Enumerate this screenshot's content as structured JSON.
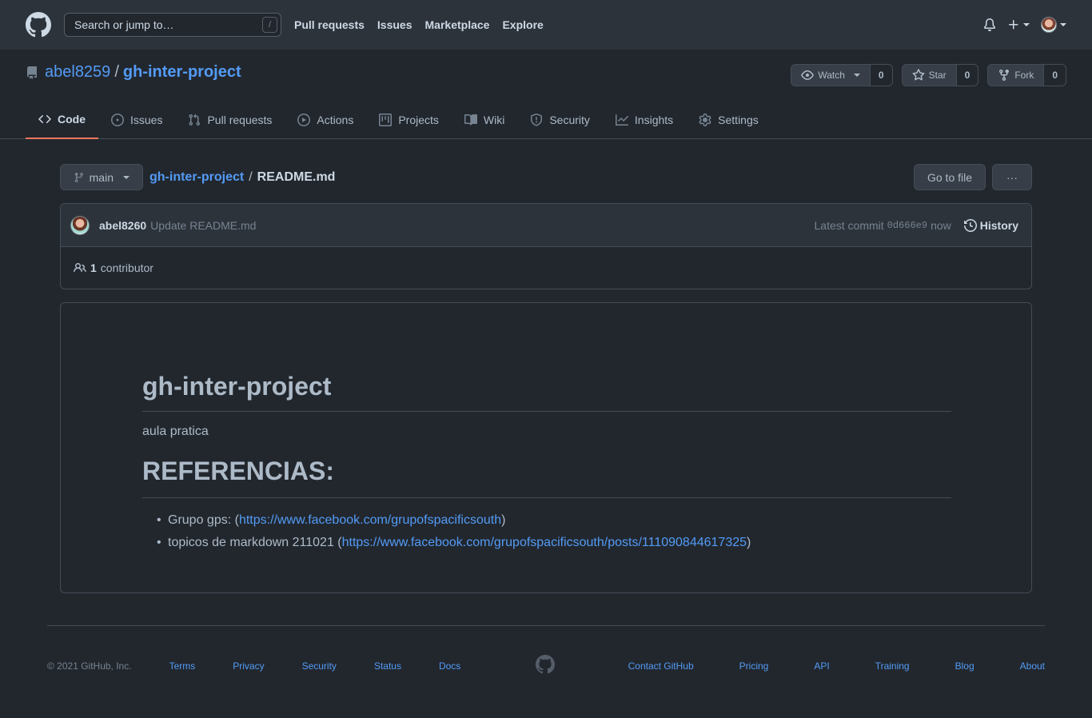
{
  "header": {
    "search_placeholder": "Search or jump to…",
    "search_key": "/",
    "nav": [
      "Pull requests",
      "Issues",
      "Marketplace",
      "Explore"
    ]
  },
  "repo": {
    "owner": "abel8259",
    "separator": "/",
    "name": "gh-inter-project",
    "watch_label": "Watch",
    "watch_count": "0",
    "star_label": "Star",
    "star_count": "0",
    "fork_label": "Fork",
    "fork_count": "0"
  },
  "tabs": [
    {
      "label": "Code",
      "icon": "code-icon"
    },
    {
      "label": "Issues",
      "icon": "issue-icon"
    },
    {
      "label": "Pull requests",
      "icon": "pull-request-icon"
    },
    {
      "label": "Actions",
      "icon": "play-icon"
    },
    {
      "label": "Projects",
      "icon": "project-icon"
    },
    {
      "label": "Wiki",
      "icon": "book-icon"
    },
    {
      "label": "Security",
      "icon": "shield-icon"
    },
    {
      "label": "Insights",
      "icon": "graph-icon"
    },
    {
      "label": "Settings",
      "icon": "gear-icon"
    }
  ],
  "file": {
    "branch": "main",
    "repo_link": "gh-inter-project",
    "slash": "/",
    "filename": "README.md",
    "goto_label": "Go to file",
    "more_label": "···"
  },
  "commit": {
    "author": "abel8260",
    "message": "Update README.md",
    "latest_label": "Latest commit",
    "sha": "0d666e9",
    "time": "now",
    "history_label": "History",
    "contributors_count": "1",
    "contributors_label": "contributor"
  },
  "readme": {
    "title": "gh-inter-project",
    "paragraph": "aula pratica",
    "section_title": "REFERENCIAS:",
    "refs": [
      {
        "prefix": "Grupo gps: (",
        "link": "https://www.facebook.com/grupofspacificsouth",
        "suffix": ")"
      },
      {
        "prefix": "topicos de markdown 211021 (",
        "link": "https://www.facebook.com/grupofspacificsouth/posts/111090844617325",
        "suffix": ")"
      }
    ]
  },
  "footer": {
    "copyright": "© 2021 GitHub, Inc.",
    "left_links": [
      "Terms",
      "Privacy",
      "Security",
      "Status",
      "Docs"
    ],
    "right_links": [
      "Contact GitHub",
      "Pricing",
      "API",
      "Training",
      "Blog",
      "About"
    ]
  },
  "colors": {
    "background": "#22272e",
    "header_bg": "#2d333b",
    "link": "#539bf5",
    "active_tab_underline": "#ec775c"
  }
}
